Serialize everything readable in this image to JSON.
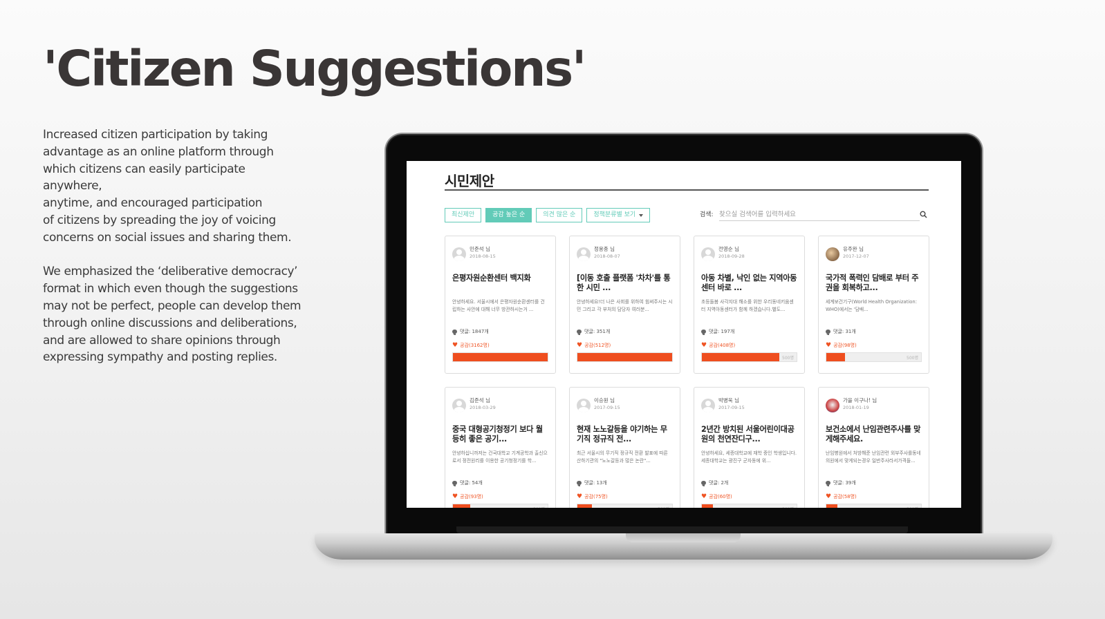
{
  "slide": {
    "title": "'Citizen Suggestions'",
    "paragraphs": [
      "Increased citizen participation by taking\nadvantage as an online platform through\nwhich citizens can easily participate anywhere,\nanytime, and encouraged participation\nof citizens by spreading the joy of voicing\nconcerns on social issues and sharing them.",
      "We emphasized the ‘deliberative democracy’\nformat in which even though the suggestions\nmay not be perfect, people can develop them\nthrough online discussions and deliberations,\nand are allowed to share opinions through\nexpressing sympathy and posting replies."
    ]
  },
  "site": {
    "title": "시민제안",
    "filters": [
      {
        "label": "최신제안",
        "active": false
      },
      {
        "label": "공감 높은 순",
        "active": true
      },
      {
        "label": "의견 많은 순",
        "active": false
      },
      {
        "label": "정책분류별 보기",
        "active": false,
        "dropdown": true
      }
    ],
    "search": {
      "label": "검색:",
      "placeholder": "찾으실 검색어를 입력하세요"
    },
    "progress_max_label": "500명",
    "cards": [
      {
        "author": "민준석 님",
        "date": "2018-08-15",
        "title": "은평자원순환센터 백지화",
        "body": "안녕하세요. 서울시에서 은평자원순환센터를 건립하는 사안에 대해 너무 방관하시는거 ...",
        "comments": "댓글: 1847개",
        "sympathy": "공감(3162명)",
        "fill": 1.0,
        "avatar": "default"
      },
      {
        "author": "정용종 님",
        "date": "2018-08-07",
        "title": "[이동 호출 플랫폼 '차차'를 통한 시민 ...",
        "body": "안녕하세요!더 나은 사회를 위하여 힘써주시는 시민 그리고 각 부처의 담당자 여러분...",
        "comments": "댓글: 351개",
        "sympathy": "공감(512명)",
        "fill": 1.0,
        "avatar": "default"
      },
      {
        "author": "전영순 님",
        "date": "2018-09-28",
        "title": "아동 차별, 낙인 없는 지역아동센터 바로 ...",
        "body": "초등돌봄 사각지대 해소를 위한 우리동네키움센터 지역아동센터가 함께 하겠습니다.별도...",
        "comments": "댓글: 197개",
        "sympathy": "공감(408명)",
        "fill": 0.816,
        "avatar": "default"
      },
      {
        "author": "유주완 님",
        "date": "2017-12-07",
        "title": "국가적 폭력인 담배로 부터 주권을 회복하고...",
        "body": "세계보건기구(World Health Organization: WHO)에서는 '담배...",
        "comments": "댓글: 31개",
        "sympathy": "공감(98명)",
        "fill": 0.196,
        "avatar": "photo"
      },
      {
        "author": "김준석 님",
        "date": "2018-03-29",
        "title": "중국 대형공기청정기 보다 월등히 좋은 공기...",
        "body": "안녕하십니까저는 건국대학교 기계공학과 출신으로서 정전원리를 이용한 공기청정기를 학...",
        "comments": "댓글: 54개",
        "sympathy": "공감(93명)",
        "fill": 0.186,
        "avatar": "default"
      },
      {
        "author": "이승원 님",
        "date": "2017-09-15",
        "title": "현재 노노갈등을 야기하는 무기직 정규직 전...",
        "body": "최근 서울시의 무기직 정규직 전환 발표에 따른 산하기관의 \"노노갈등과 많은 논란\"...",
        "comments": "댓글: 13개",
        "sympathy": "공감(75명)",
        "fill": 0.15,
        "avatar": "default"
      },
      {
        "author": "박병욱 님",
        "date": "2017-09-15",
        "title": "2년간 방치된 서울어린이대공원의 천연잔디구...",
        "body": "안녕하세요, 세종대학교에 재학 중인 학생입니다. 세종대학교는 광진구 군자동에 위...",
        "comments": "댓글: 2개",
        "sympathy": "공감(60명)",
        "fill": 0.12,
        "avatar": "default"
      },
      {
        "author": "가을 이구나! 님",
        "date": "2018-01-19",
        "title": "보건소에서 난임관련주사를 맞게해주세요.",
        "body": "난임병원에서 처방해준 난임관련 외부주사를동네의원에서 맞게되는경우 일반주사라서가격들...",
        "comments": "댓글: 39개",
        "sympathy": "공감(58명)",
        "fill": 0.116,
        "avatar": "photo2"
      }
    ]
  },
  "colors": {
    "accent": "#62cbb8",
    "progress": "#ef4e1f",
    "title": "#3a3636"
  }
}
